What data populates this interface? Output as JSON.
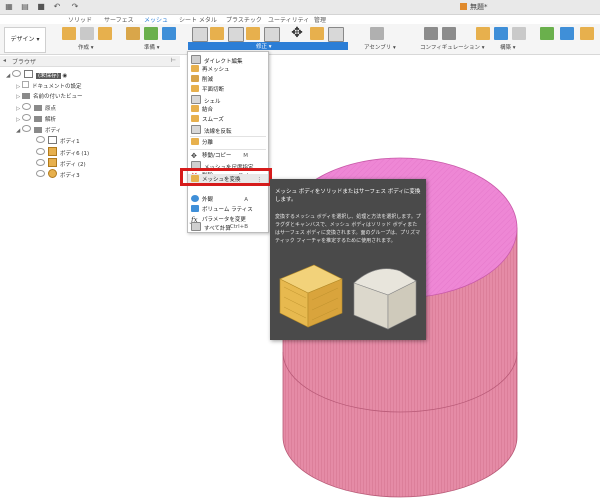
{
  "top_bar": {
    "document_title": "無題*"
  },
  "ribbon": {
    "design_button": "デザイン",
    "tabs": [
      "ソリッド",
      "サーフェス",
      "メッシュ",
      "シート メタル",
      "プラスチック",
      "ユーティリティ",
      "管理"
    ],
    "active_tab": "メッシュ",
    "groups": {
      "create": "作成",
      "prepare": "準備",
      "fix": "修正",
      "assemble": "アセンブリ",
      "configure": "コンフィギュレーション",
      "construct": "構築"
    }
  },
  "browser": {
    "title": "ブラウザ",
    "root": "(未保存)",
    "items": [
      {
        "label": "ドキュメントの設定"
      },
      {
        "label": "名前の付いたビュー"
      },
      {
        "label": "原点"
      },
      {
        "label": "解析"
      },
      {
        "label": "ボディ"
      },
      {
        "label": "ボディ1"
      },
      {
        "label": "ボディ6 (1)"
      },
      {
        "label": "ボディ (2)"
      },
      {
        "label": "ボディ3"
      }
    ]
  },
  "menu": {
    "items": [
      {
        "label": "ダイレクト編集",
        "shortcut": "",
        "icon": "direct-edit-icon"
      },
      {
        "label": "再メッシュ",
        "shortcut": "",
        "icon": "remesh-icon"
      },
      {
        "label": "削減",
        "shortcut": "",
        "icon": "reduce-icon"
      },
      {
        "label": "平面切断",
        "shortcut": "",
        "icon": "plane-cut-icon"
      },
      {
        "label": "シェル",
        "shortcut": "",
        "icon": "shell-icon"
      },
      {
        "label": "結合",
        "shortcut": "",
        "icon": "combine-icon"
      },
      {
        "label": "スムーズ",
        "shortcut": "",
        "icon": "smooth-icon"
      },
      {
        "label": "法線を反転",
        "shortcut": "",
        "icon": "reverse-normal-icon"
      },
      {
        "label": "分離",
        "shortcut": "",
        "icon": "separate-icon"
      },
      {
        "label": "移動/コピー",
        "shortcut": "M",
        "icon": "move-icon"
      },
      {
        "label": "メッシュを尺度指定",
        "shortcut": "",
        "icon": "scale-mesh-icon"
      },
      {
        "label": "削除",
        "shortcut": "Del",
        "icon": "delete-icon"
      },
      {
        "label": "メッシュを変換",
        "shortcut": "",
        "icon": "convert-mesh-icon"
      },
      {
        "label": "外観",
        "shortcut": "A",
        "icon": "appearance-icon"
      },
      {
        "label": "ボリューム ラティス",
        "shortcut": "",
        "icon": "volume-lattice-icon"
      },
      {
        "label": "パラメータを変更",
        "shortcut": "",
        "icon": "parameters-icon"
      },
      {
        "label": "すべて計算",
        "shortcut": "Ctrl+B",
        "icon": "compute-icon"
      }
    ]
  },
  "tooltip": {
    "title": "メッシュ ボディをソリッドまたはサーフェス ボディに変換します。",
    "body": "変換するメッシュ ボディを選択し、処理と方法を選択します。プラグダとキャンバスで、メッシュ ボディはソリッド ボディまたはサーフェス ボディに変換されます。面のグループは、プリズマティック フィーチャを推定するために使用されます。"
  },
  "colors": {
    "accent": "#2c7ed6",
    "highlight_red": "#d61b1b",
    "cylinder_side": "#e58ba6",
    "cylinder_top": "#ee87d5",
    "tooltip_bg": "#4a4a4a"
  }
}
